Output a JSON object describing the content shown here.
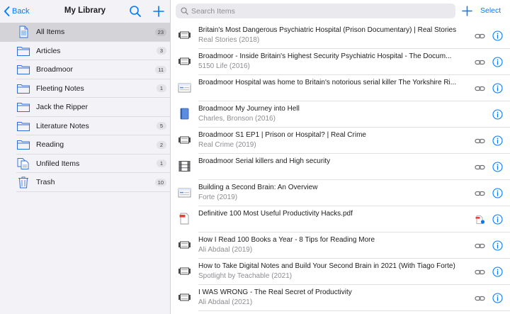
{
  "left_header": {
    "back_label": "Back",
    "title": "My Library"
  },
  "collections": [
    {
      "label": "All Items",
      "count": "23",
      "icon": "document-icon",
      "selected": true
    },
    {
      "label": "Articles",
      "count": "3",
      "icon": "folder-icon"
    },
    {
      "label": "Broadmoor",
      "count": "11",
      "icon": "folder-icon"
    },
    {
      "label": "Fleeting Notes",
      "count": "1",
      "icon": "folder-icon"
    },
    {
      "label": "Jack the Ripper",
      "count": "",
      "icon": "folder-icon"
    },
    {
      "label": "Literature Notes",
      "count": "5",
      "icon": "folder-icon"
    },
    {
      "label": "Reading",
      "count": "2",
      "icon": "folder-icon"
    },
    {
      "label": "Unfiled Items",
      "count": "1",
      "icon": "unfiled-icon"
    },
    {
      "label": "Trash",
      "count": "10",
      "icon": "trash-icon"
    }
  ],
  "search": {
    "placeholder": "Search Items"
  },
  "right_header": {
    "select_label": "Select"
  },
  "items": [
    {
      "title": "Britain's Most Dangerous Psychiatric Hospital (Prison Documentary) | Real Stories",
      "subtitle": "Real Stories (2018)",
      "type": "video-icon",
      "attachment": "link-icon"
    },
    {
      "title": "Broadmoor - Inside Britain's Highest Security Psychiatric Hospital - The Docum...",
      "subtitle": "5150 Life (2016)",
      "type": "video-icon",
      "attachment": "link-icon"
    },
    {
      "title": "Broadmoor Hospital was home to Britain's notorious serial killer The Yorkshire Ri...",
      "subtitle": "",
      "type": "webpage-icon",
      "attachment": "link-icon"
    },
    {
      "title": "Broadmoor My Journey into Hell",
      "subtitle": "Charles, Bronson (2016)",
      "type": "book-icon",
      "attachment": ""
    },
    {
      "title": "Broadmoor S1 EP1 | Prison or Hospital? | Real Crime",
      "subtitle": "Real Crime (2019)",
      "type": "video-icon",
      "attachment": "link-icon"
    },
    {
      "title": "Broadmoor Serial killers and High security",
      "subtitle": "",
      "type": "film-icon",
      "attachment": "link-icon"
    },
    {
      "title": "Building a Second Brain: An Overview",
      "subtitle": "Forte (2019)",
      "type": "webpage-icon",
      "attachment": "link-icon"
    },
    {
      "title": "Definitive 100 Most Useful Productivity Hacks.pdf",
      "subtitle": "",
      "type": "pdf-icon",
      "attachment": "pdf-badge-icon"
    },
    {
      "title": "How I Read 100 Books a Year - 8 Tips for Reading More",
      "subtitle": "Ali Abdaal (2019)",
      "type": "video-icon",
      "attachment": "link-icon"
    },
    {
      "title": "How to Take Digital Notes and Build Your Second Brain in 2021 (With Tiago Forte)",
      "subtitle": "Spotlight by Teachable (2021)",
      "type": "video-icon",
      "attachment": "link-icon"
    },
    {
      "title": "I WAS WRONG - The Real Secret of Productivity",
      "subtitle": "Ali Abdaal (2021)",
      "type": "video-icon",
      "attachment": "link-icon"
    }
  ],
  "colors": {
    "accent": "#007aff",
    "sidebar_bg": "#f2f2f7",
    "selected_bg": "#d4d4d8",
    "pdf_red": "#e0443e"
  }
}
